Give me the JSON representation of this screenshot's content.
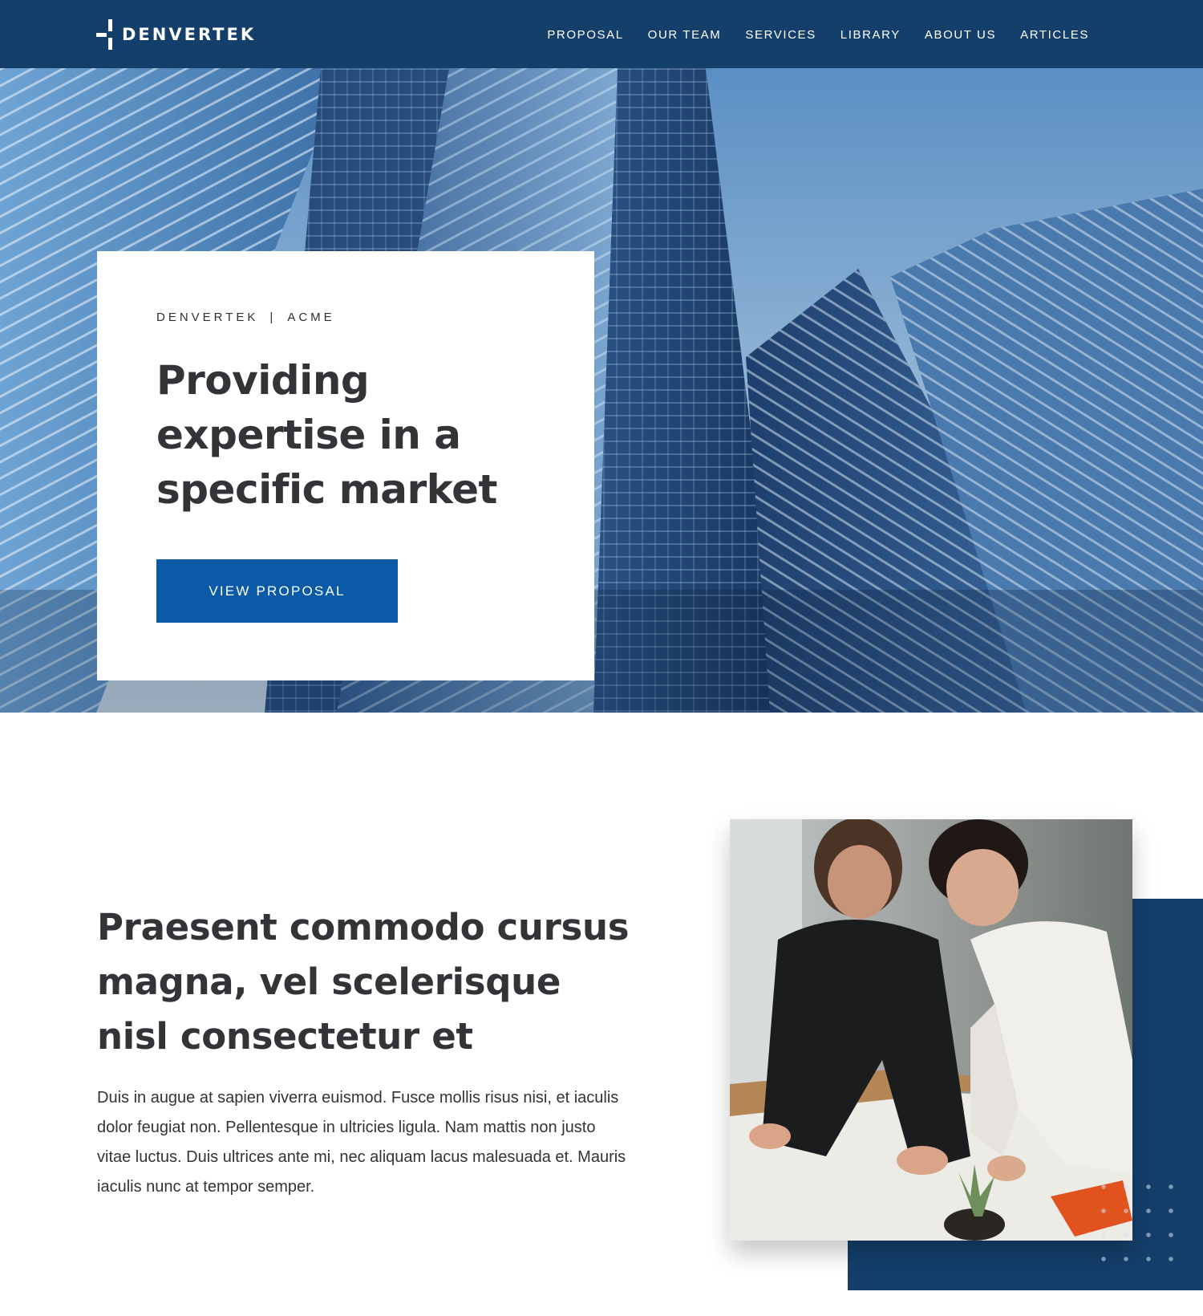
{
  "brand": {
    "name": "DENVERTEK"
  },
  "nav": {
    "items": [
      {
        "label": "PROPOSAL"
      },
      {
        "label": "OUR TEAM"
      },
      {
        "label": "SERVICES"
      },
      {
        "label": "LIBRARY"
      },
      {
        "label": "ABOUT US"
      },
      {
        "label": "ARTICLES"
      }
    ]
  },
  "hero": {
    "eyebrow_left": "DENVERTEK",
    "eyebrow_sep": "|",
    "eyebrow_right": "ACME",
    "title": "Providing expertise in a specific market",
    "cta_label": "VIEW PROPOSAL",
    "background_image": "skyscrapers-photo"
  },
  "intro": {
    "title": "Praesent commodo cursus magna, vel scelerisque nisl consectetur et",
    "body": "Duis in augue at sapien viverra euismod. Fusce mollis risus nisi, et iaculis dolor feugiat non. Pellentesque in ultricies ligula. Nam mattis non justo vitae luctus. Duis ultrices ante mi, nec aliquam lacus malesuada et. Mauris iaculis nunc at tempor semper.",
    "image": "team-collaboration-photo"
  },
  "colors": {
    "header_bg": "#143f6b",
    "cta_bg": "#0b5aa7",
    "accent_block": "#143f6b",
    "text_dark": "#333338"
  }
}
